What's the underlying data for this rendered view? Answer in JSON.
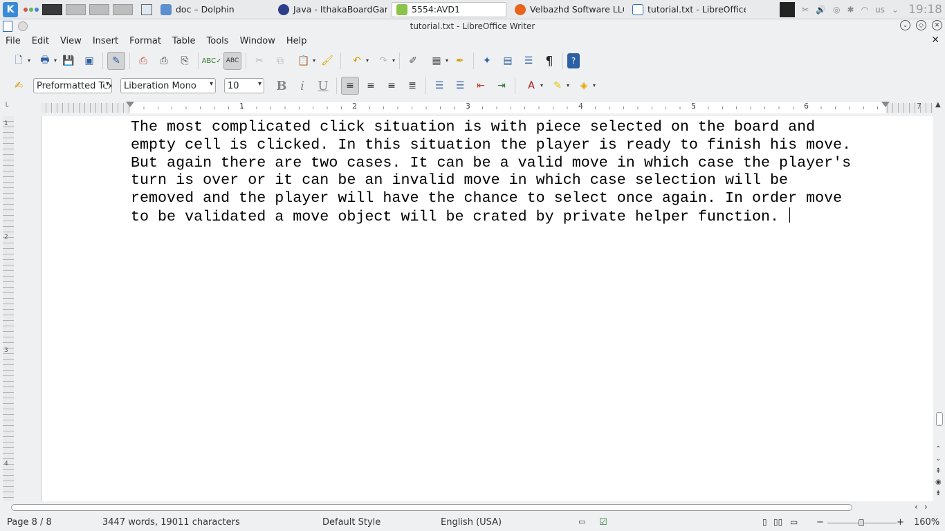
{
  "taskbar": {
    "tasks": [
      {
        "label": "doc – Dolphin",
        "color": "#5b8fd0",
        "active": false
      },
      {
        "label": "Java - IthakaBoardGame",
        "color": "#2c3e8a",
        "active": false
      },
      {
        "label": "5554:AVD1",
        "color": "#8bc34a",
        "active": true
      },
      {
        "label": "Velbazhd Software LLC",
        "color": "#e8641b",
        "active": false
      },
      {
        "label": "tutorial.txt - LibreOffice",
        "color": "#2a6db3",
        "active": false
      }
    ],
    "keyboard_layout": "us",
    "clock": "19:18"
  },
  "window": {
    "title": "tutorial.txt - LibreOffice Writer"
  },
  "menu": [
    "File",
    "Edit",
    "View",
    "Insert",
    "Format",
    "Table",
    "Tools",
    "Window",
    "Help"
  ],
  "formatting": {
    "paragraph_style": "Preformatted Text",
    "font_name": "Liberation Mono",
    "font_size": "10"
  },
  "ruler": {
    "numbers": [
      "1",
      "2",
      "3",
      "4",
      "5",
      "6",
      "7"
    ],
    "vnumbers": [
      "1",
      "2",
      "3",
      "4"
    ]
  },
  "document": {
    "lines": [
      "The most complicated click situation is with piece selected on the board and",
      "empty cell is clicked. In this situation the player is ready to finish his move.",
      "But again there are two cases. It can be a valid move in which case the player's",
      "turn is over or it can be an invalid move in which case selection will be",
      "removed and the player will have the chance to select once again. In order move",
      "to be validated a move object will be crated by private helper function. "
    ]
  },
  "status": {
    "page": "Page 8 / 8",
    "words": "3447 words, 19011 characters",
    "style": "Default Style",
    "language": "English (USA)",
    "zoom": "160%"
  }
}
